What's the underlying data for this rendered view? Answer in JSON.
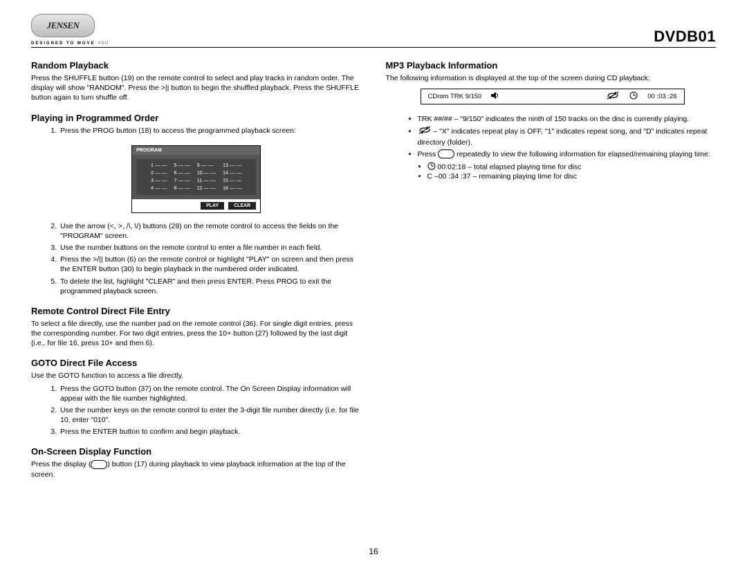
{
  "header": {
    "brand": "JENSEN",
    "tagline_a": "DESIGNED TO MOVE",
    "tagline_b": "YOU",
    "model": "DVDB01"
  },
  "left": {
    "random": {
      "title": "Random Playback",
      "body": "Press the SHUFFLE button (19) on the remote control to select and play tracks in random order. The display will show \"RANDOM\". Press the >|| button to begin the shuffled playback. Press the SHUFFLE button again to turn shuffle off."
    },
    "prog": {
      "title": "Playing in Programmed Order",
      "step1": "Press the PROG button (18) to access the programmed playback screen:",
      "box": {
        "title": "PROGRAM",
        "rows": [
          [
            "1  ––  ––",
            "5  –– ––",
            "9   –– ––",
            "13  –– ––"
          ],
          [
            "2  ––  ––",
            "6  –– ––",
            "10  –– ––",
            "14  –– ––"
          ],
          [
            "3  ––  ––",
            "7  –– ––",
            "11  –– ––",
            "15  –– ––"
          ],
          [
            "4  ––  ––",
            "8  –– ––",
            "12  –– ––",
            "16  –– ––"
          ]
        ],
        "play": "PLAY",
        "clear": "CLEAR"
      },
      "step2": "Use the arrow (<, >, /\\, \\/) buttons (29) on the remote control to access the fields on the \"PROGRAM\" screen.",
      "step3": "Use the number buttons on the remote control to enter a file number in each field.",
      "step4": "Press the >/|| button (6) on the remote control or highlight \"PLAY\" on screen and then press the ENTER button (30) to begin playback in the numbered order indicated.",
      "step5": "To delete the list, highlight \"CLEAR\" and then press ENTER. Press PROG to exit the programmed playback screen."
    },
    "remote": {
      "title": "Remote Control Direct File Entry",
      "body": "To select a file directly, use the number pad on the remote control (36). For single digit entries, press the corresponding number. For two digit entries, press the 10+ button (27) followed by the last digit (i.e., for file 16, press 10+ and then 6)."
    },
    "goto": {
      "title": "GOTO Direct File Access",
      "intro": "Use the GOTO function to access a file directly.",
      "step1": "Press the GOTO button (37) on the remote control. The On Screen Display information will appear with the file number highlighted.",
      "step2": "Use the number keys on the remote control to enter the 3-digit file number directly (i.e. for file 10, enter \"010\".",
      "step3": "Press the ENTER button to confirm and begin playback."
    },
    "osd": {
      "title": "On-Screen Display Function",
      "body_a": "Press the display (",
      "body_b": ") button (17) during playback to view playback information at the top of the screen."
    }
  },
  "right": {
    "mp3": {
      "title": "MP3 Playback Information",
      "intro": "The following information is displayed at the top of the screen during CD playback:",
      "bar": {
        "left": "CDrom   TRK   9/150",
        "time": "00 :03 :26"
      },
      "b1": "TRK ##/## – \"9/150\" indicates the ninth of 150 tracks on the disc is currently playing.",
      "b2_a": "",
      "b2_b": " – \"X\" indicates repeat play is OFF, \"1\" indicates repeat song, and \"D\" indicates repeat directory (folder).",
      "b3_a": "Press ",
      "b3_b": " repeatedly to view the following information for elapsed/remaining playing time:",
      "s1": " 00:02:18 – total elapsed playing time for disc",
      "s2": "C –00 :34 :37 – remaining playing time for disc"
    }
  },
  "pagenum": "16"
}
